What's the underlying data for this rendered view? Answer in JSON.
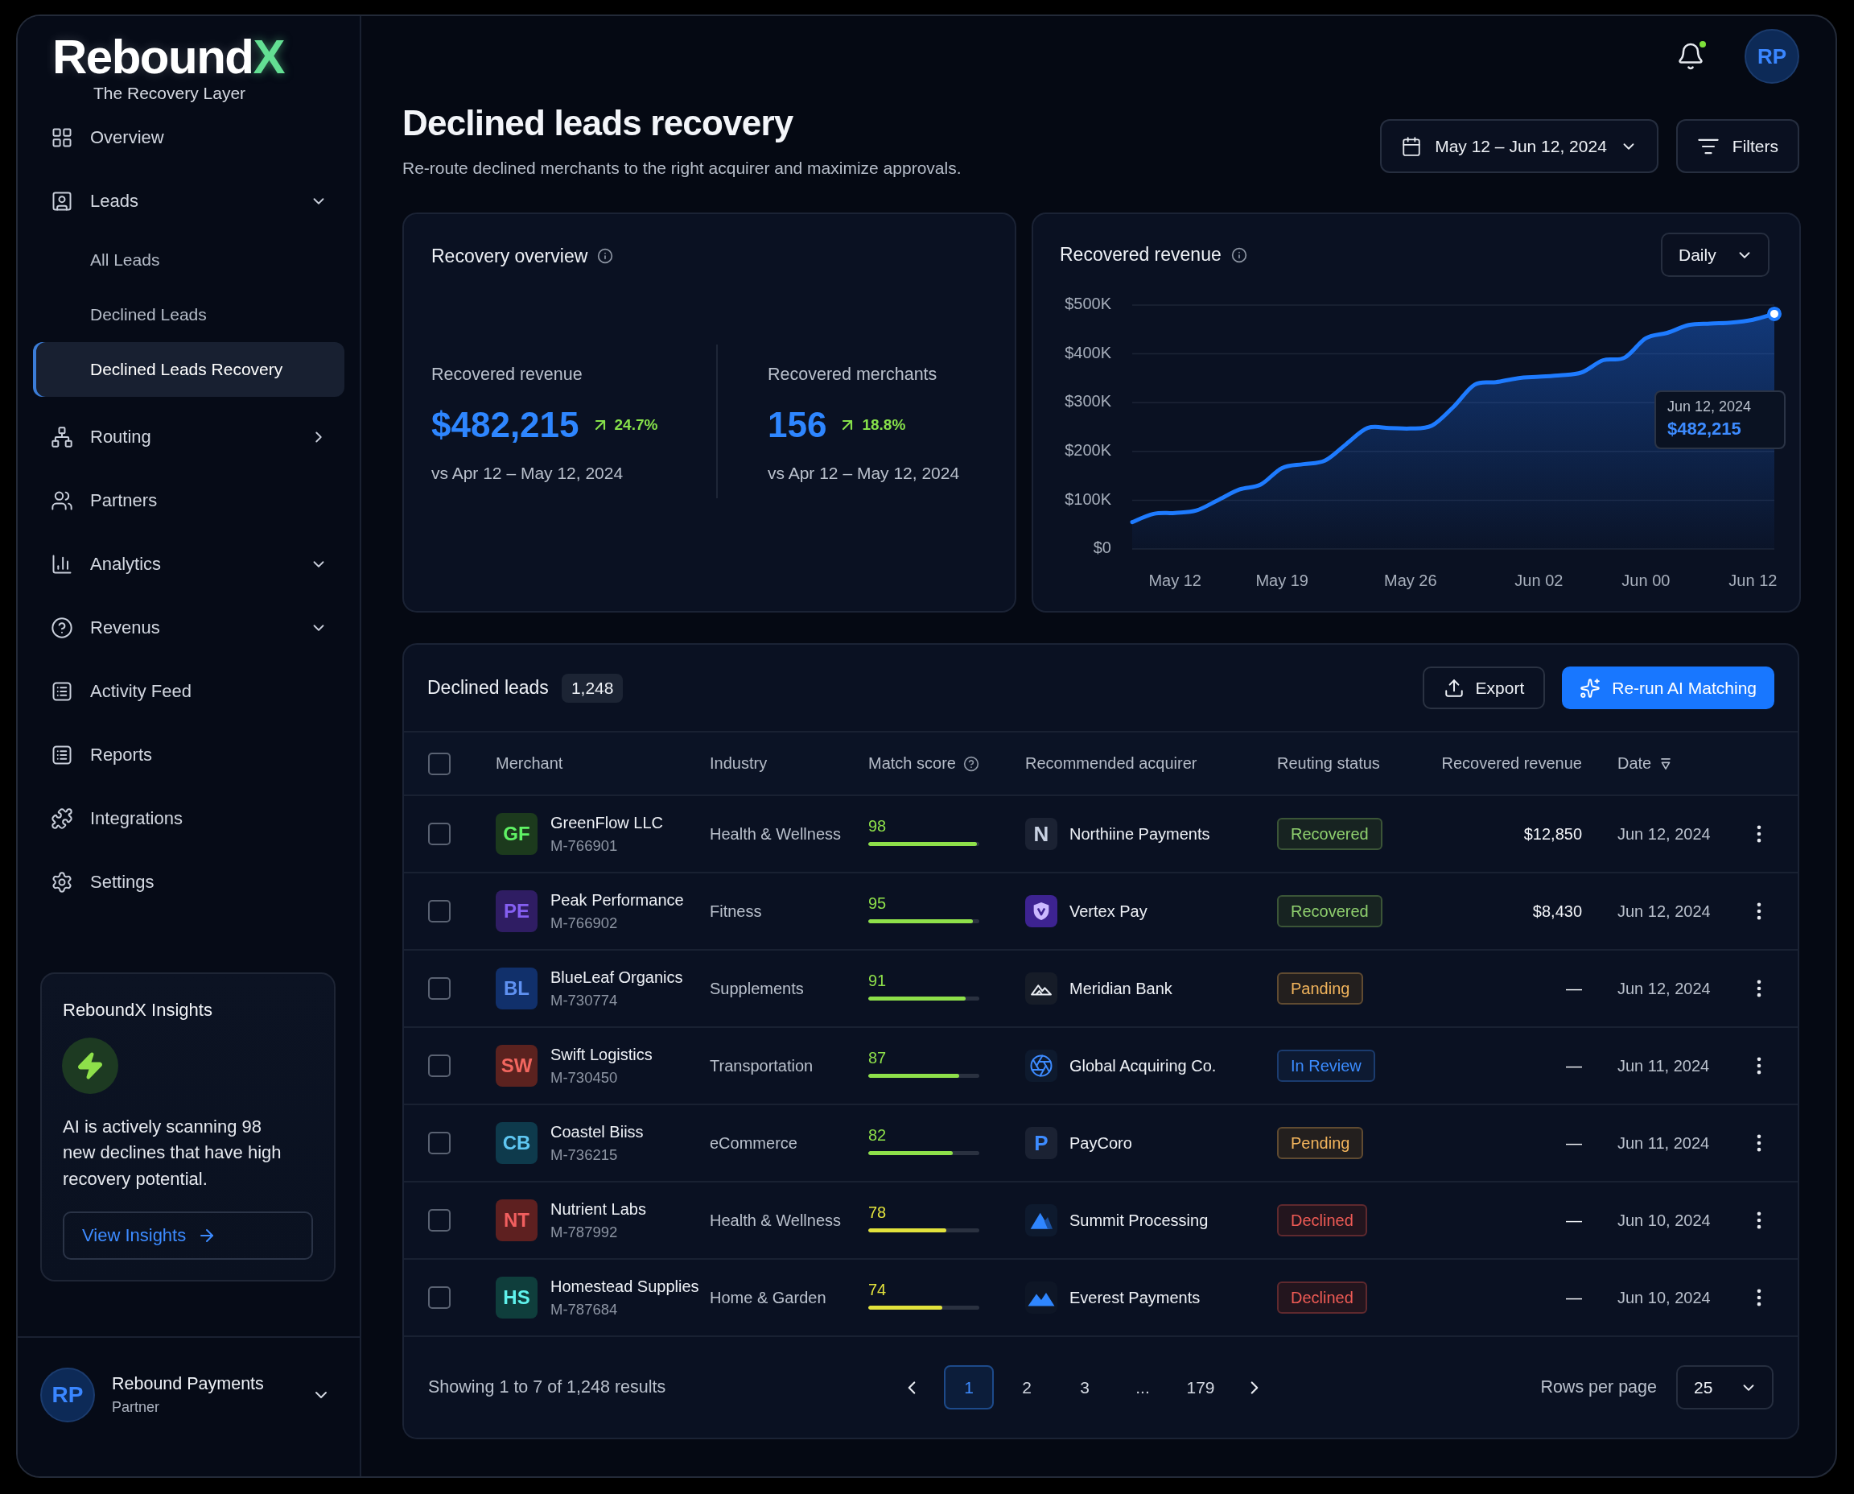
{
  "sidebar": {
    "logo": {
      "text": "Rebound",
      "accent": "X",
      "tagline": "The Recovery Layer"
    },
    "nav": [
      {
        "label": "Overview",
        "selected": false
      },
      {
        "label": "Leads",
        "selected": false,
        "expanded": true,
        "children": [
          {
            "label": "All Leads",
            "selected": false
          },
          {
            "label": "Declined Leads",
            "selected": false
          },
          {
            "label": "Declined Leads Recovery",
            "selected": true
          }
        ]
      },
      {
        "label": "Routing",
        "selected": false,
        "expanded": false
      },
      {
        "label": "Partners",
        "selected": false
      },
      {
        "label": "Analytics",
        "selected": false,
        "expanded": true
      },
      {
        "label": "Revenus",
        "selected": false,
        "expanded": true
      },
      {
        "label": "Activity Feed",
        "selected": false
      },
      {
        "label": "Reports",
        "selected": false
      },
      {
        "label": "Integrations",
        "selected": false
      },
      {
        "label": "Settings",
        "selected": false
      }
    ],
    "insights": {
      "title": "ReboundX Insights",
      "text": "AI is actively scanning 98 new declines that have high recovery potential.",
      "button": "View Insights"
    },
    "account": {
      "initials": "RP",
      "name": "Rebound Payments",
      "role": "Partner"
    }
  },
  "topbar": {
    "notifications": {
      "unread": true
    },
    "avatar": "RP"
  },
  "header": {
    "title": "Declined leads recovery",
    "subtitle": "Re-route declined merchants to the right acquirer and maximize approvals.",
    "date_range": "May 12 – Jun 12, 2024",
    "filters": "Filters"
  },
  "overview": {
    "title": "Recovery overview",
    "metrics": [
      {
        "label": "Recovered revenue",
        "value": "$482,215",
        "change": "24.7%",
        "comparison": "vs Apr 12 – May 12, 2024"
      },
      {
        "label": "Recovered merchants",
        "value": "156",
        "change": "18.8%",
        "comparison": "vs Apr 12 – May 12, 2024"
      }
    ]
  },
  "revenue": {
    "title": "Recovered revenue",
    "period": "Daily",
    "chart_data": {
      "type": "area",
      "grid": true,
      "categories": [
        null,
        null,
        "May 12",
        null,
        null,
        null,
        null,
        "May 19",
        null,
        null,
        null,
        null,
        null,
        "May 26",
        null,
        null,
        null,
        null,
        null,
        "Jun 02",
        null,
        null,
        null,
        null,
        "Jun 00",
        null,
        null,
        null,
        null,
        "Jun 12",
        null
      ],
      "series": [
        {
          "color": "#1e7bff",
          "values": [
            55000,
            72000,
            74000,
            79000,
            100000,
            122000,
            132000,
            166000,
            174000,
            181000,
            215000,
            248000,
            248000,
            247000,
            253000,
            291000,
            337000,
            342000,
            350000,
            353000,
            356000,
            362000,
            387000,
            392000,
            432000,
            443000,
            459000,
            462000,
            464000,
            470000,
            482000
          ]
        }
      ],
      "ylim": [
        0,
        500000
      ],
      "yticks": [
        {
          "value": 0,
          "label": "$0"
        },
        {
          "value": 100000,
          "label": "$100K"
        },
        {
          "value": 200000,
          "label": "$200K"
        },
        {
          "value": 300000,
          "label": "$300K"
        },
        {
          "value": 400000,
          "label": "$400K"
        },
        {
          "value": 500000,
          "label": "$500K"
        }
      ]
    },
    "tooltip": {
      "date": "Jun 12, 2024",
      "value": "$482,215"
    }
  },
  "table": {
    "title": "Declined leads",
    "count": "1,248",
    "actions": [
      {
        "label": "Export",
        "kind": "secondary"
      },
      {
        "label": "Re-run AI Matching",
        "kind": "primary"
      }
    ],
    "select_all": {
      "checked": false
    },
    "columns": [
      {
        "label": "Merchant",
        "kind": "text"
      },
      {
        "label": "Industry",
        "kind": "text"
      },
      {
        "label": "Match score",
        "kind": "hint"
      },
      {
        "label": "Recommended acquirer",
        "kind": "text"
      },
      {
        "label": "Reuting status",
        "kind": "text"
      },
      {
        "label": "Recovered revenue",
        "kind": "text"
      },
      {
        "label": "Date",
        "kind": "sortable"
      }
    ],
    "rows": [
      {
        "checked": false,
        "merchant": {
          "initials": "GF",
          "color": "#1c3a1d",
          "name": "GreenFlow LLC",
          "id": "M-766901"
        },
        "industry": "Health & Wellness",
        "score": {
          "value": "98",
          "level": 0.98,
          "color": "#8ee04a"
        },
        "acquirer": {
          "name": "Northiine Payments",
          "logo": {
            "kind": "letter",
            "text": "N",
            "color": "#c9d2e3"
          }
        },
        "status": {
          "label": "Recovered",
          "color": "#8fcf6e"
        },
        "revenue": "$12,850",
        "date": "Jun 12, 2024"
      },
      {
        "checked": false,
        "merchant": {
          "initials": "PE",
          "color": "#2f1d63",
          "name": "Peak Performance",
          "id": "M-766902"
        },
        "industry": "Fitness",
        "score": {
          "value": "95",
          "level": 0.94,
          "color": "#8ee04a"
        },
        "acquirer": {
          "name": "Vertex Pay",
          "logo": {
            "kind": "shield"
          }
        },
        "status": {
          "label": "Recovered",
          "color": "#8fcf6e"
        },
        "revenue": "$8,430",
        "date": "Jun 12, 2024"
      },
      {
        "checked": false,
        "merchant": {
          "initials": "BL",
          "color": "#11306b",
          "name": "BlueLeaf Organics",
          "id": "M-730774"
        },
        "industry": "Supplements",
        "score": {
          "value": "91",
          "level": 0.88,
          "color": "#8ee04a"
        },
        "acquirer": {
          "name": "Meridian Bank",
          "logo": {
            "kind": "hills"
          }
        },
        "status": {
          "label": "Panding",
          "color": "#f2b45c"
        },
        "revenue": "—",
        "date": "Jun 12, 2024"
      },
      {
        "checked": false,
        "merchant": {
          "initials": "SW",
          "color": "#5b221f",
          "name": "Swift Logistics",
          "id": "M-730450"
        },
        "industry": "Transportation",
        "score": {
          "value": "87",
          "level": 0.82,
          "color": "#8ee04a"
        },
        "acquirer": {
          "name": "Global Acquiring Co.",
          "logo": {
            "kind": "swirl"
          }
        },
        "status": {
          "label": "In Review",
          "color": "#3b8cff"
        },
        "revenue": "—",
        "date": "Jun 11, 2024"
      },
      {
        "checked": false,
        "merchant": {
          "initials": "CB",
          "color": "#0e3a4c",
          "name": "Coastel Biiss",
          "id": "M-736215"
        },
        "industry": "eCommerce",
        "score": {
          "value": "82",
          "level": 0.76,
          "color": "#8ee04a"
        },
        "acquirer": {
          "name": "PayCoro",
          "logo": {
            "kind": "letter",
            "text": "P",
            "color": "#3d8bff"
          }
        },
        "status": {
          "label": "Pending",
          "color": "#f2b45c"
        },
        "revenue": "—",
        "date": "Jun 11, 2024"
      },
      {
        "checked": false,
        "merchant": {
          "initials": "NT",
          "color": "#5e2020",
          "name": "Nutrient Labs",
          "id": "M-787992"
        },
        "industry": "Health & Wellness",
        "score": {
          "value": "78",
          "level": 0.7,
          "color": "#e2e23c"
        },
        "acquirer": {
          "name": "Summit Processing",
          "logo": {
            "kind": "peak"
          }
        },
        "status": {
          "label": "Declined",
          "color": "#ef5b55"
        },
        "revenue": "—",
        "date": "Jun 10, 2024"
      },
      {
        "checked": false,
        "merchant": {
          "initials": "HS",
          "color": "#0f3e3c",
          "name": "Homestead Supplies",
          "id": "M-787684"
        },
        "industry": "Home & Garden",
        "score": {
          "value": "74",
          "level": 0.67,
          "color": "#e2e23c"
        },
        "acquirer": {
          "name": "Everest Payments",
          "logo": {
            "kind": "range"
          }
        },
        "status": {
          "label": "Declined",
          "color": "#ef5b55"
        },
        "revenue": "—",
        "date": "Jun 10, 2024"
      }
    ]
  },
  "pagination": {
    "summary": "Showing 1 to 7 of 1,248 results",
    "pages": [
      {
        "label": "1",
        "selected": true
      },
      {
        "label": "2",
        "selected": false
      },
      {
        "label": "3",
        "selected": false
      },
      {
        "label": "...",
        "selected": false
      },
      {
        "label": "179",
        "selected": false
      }
    ],
    "rows_per_page_label": "Rows per page",
    "rows_per_page": "25"
  }
}
